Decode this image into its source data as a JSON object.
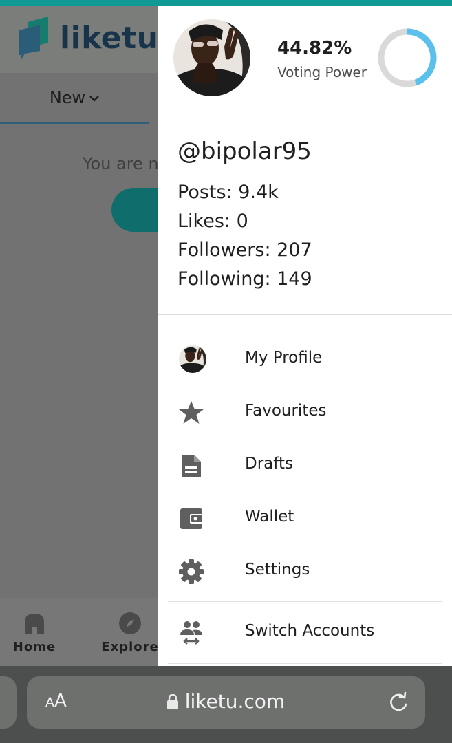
{
  "app": {
    "logo_text": "liketu",
    "feed_tab": "New",
    "notice_text": "You are n",
    "bottom_nav": [
      {
        "label": "Home",
        "icon": "home-icon"
      },
      {
        "label": "Explore",
        "icon": "compass-icon"
      }
    ]
  },
  "drawer": {
    "voting_power": {
      "value": "44.82%",
      "label": "Voting Power",
      "fraction": 0.4482
    },
    "username": "@bipolar95",
    "stats": {
      "posts": "Posts: 9.4k",
      "likes": "Likes: 0",
      "followers": "Followers: 207",
      "following": "Following: 149"
    },
    "menu": [
      {
        "label": "My Profile",
        "icon": "avatar-icon"
      },
      {
        "label": "Favourites",
        "icon": "star-icon"
      },
      {
        "label": "Drafts",
        "icon": "document-icon"
      },
      {
        "label": "Wallet",
        "icon": "wallet-icon"
      },
      {
        "label": "Settings",
        "icon": "gear-icon"
      },
      {
        "label": "Switch Accounts",
        "icon": "switch-accounts-icon"
      }
    ]
  },
  "browser": {
    "text_size_label": "AA",
    "url": "liketu.com"
  },
  "colors": {
    "teal_accent": "#109a95",
    "ring_fill": "#5bc0ec",
    "ring_track": "#d9d9d9",
    "icon_gray": "#5f5f5f"
  }
}
